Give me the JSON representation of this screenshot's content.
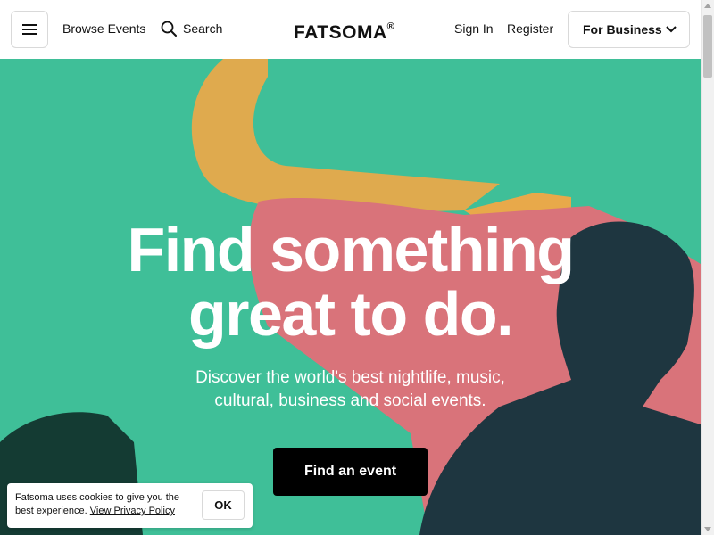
{
  "header": {
    "browse_label": "Browse Events",
    "search_label": "Search",
    "logo_text": "FATSOMA",
    "logo_mark": "®",
    "signin_label": "Sign In",
    "register_label": "Register",
    "business_label": "For Business"
  },
  "hero": {
    "title_line1": "Find something",
    "title_line2": "great to do.",
    "subtitle_line1": "Discover the world's best nightlife, music,",
    "subtitle_line2": "cultural, business and social events.",
    "cta_label": "Find an event"
  },
  "cookie": {
    "text": "Fatsoma uses cookies to give you the best experience.",
    "link_label": "View Privacy Policy",
    "ok_label": "OK"
  },
  "colors": {
    "hero_green": "#3fbf98",
    "hero_orange": "#e8a94a",
    "hero_pink": "#d9737a",
    "cta_background": "#000000",
    "text_dark": "#111111"
  },
  "icons": [
    "hamburger-menu-icon",
    "search-icon",
    "chevron-down-icon"
  ]
}
